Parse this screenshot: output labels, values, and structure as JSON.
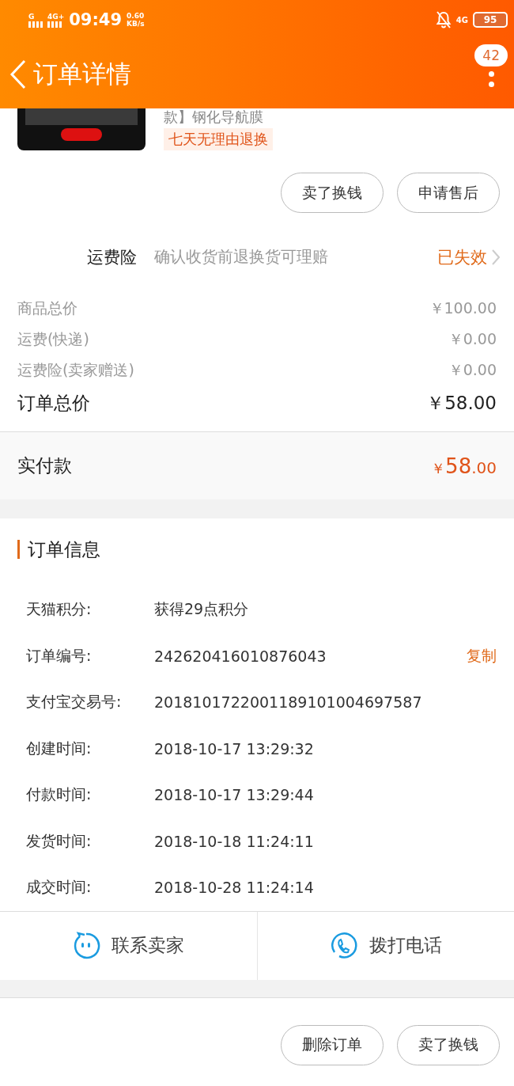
{
  "status_bar": {
    "network_1": "G",
    "network_2": "4G+",
    "time": "09:49",
    "speed": "0.60",
    "speed_unit": "KB/s",
    "network_3": "4G",
    "battery": "95"
  },
  "header": {
    "title": "订单详情",
    "badge": "42"
  },
  "product": {
    "title": "款】钢化导航膜",
    "tag": "七天无理由退换"
  },
  "item_actions": [
    "卖了换钱",
    "申请售后"
  ],
  "insurance": {
    "label": "运费险",
    "description": "确认收货前退换货可理赔",
    "status": "已失效"
  },
  "price_rows": [
    {
      "label": "商品总价",
      "value": "￥100.00",
      "kind": "minor"
    },
    {
      "label": "运费(快递)",
      "value": "￥0.00",
      "kind": "minor"
    },
    {
      "label": "运费险(卖家赠送)",
      "value": "￥0.00",
      "kind": "minor"
    },
    {
      "label": "订单总价",
      "value": "￥58.00",
      "kind": "total"
    }
  ],
  "paid": {
    "label": "实付款",
    "currency": "￥",
    "integer": "58",
    "decimal": ".00"
  },
  "order_info": {
    "title": "订单信息",
    "rows": [
      {
        "label": "天猫积分:",
        "value": "获得29点积分"
      },
      {
        "label": "订单编号:",
        "value": "242620416010876043",
        "action": "复制"
      },
      {
        "label": "支付宝交易号:",
        "value": "2018101722001189101004697587"
      },
      {
        "label": "创建时间:",
        "value": "2018-10-17 13:29:32"
      },
      {
        "label": "付款时间:",
        "value": "2018-10-17 13:29:44"
      },
      {
        "label": "发货时间:",
        "value": "2018-10-18 11:24:11"
      },
      {
        "label": "成交时间:",
        "value": "2018-10-28 11:24:14"
      }
    ]
  },
  "contact": [
    {
      "kind": "chat",
      "label": "联系卖家"
    },
    {
      "kind": "phone",
      "label": "拨打电话"
    }
  ],
  "bottom_actions": [
    "删除订单",
    "卖了换钱"
  ]
}
